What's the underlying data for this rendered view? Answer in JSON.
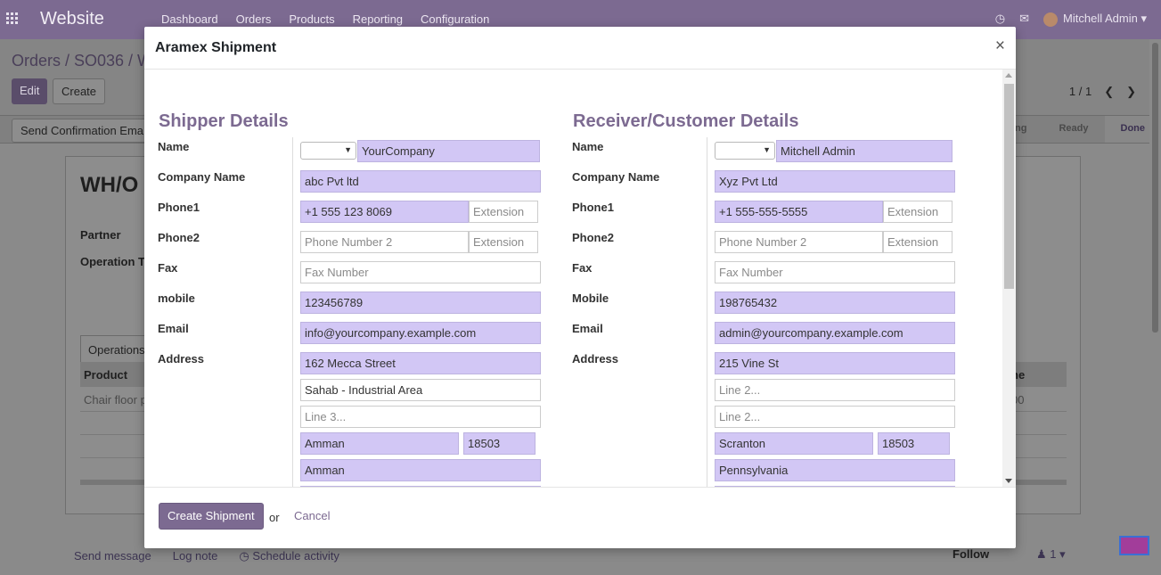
{
  "navbar": {
    "brand": "Website",
    "menu": [
      "Dashboard",
      "Orders",
      "Products",
      "Reporting",
      "Configuration"
    ],
    "user": "Mitchell Admin"
  },
  "background": {
    "breadcrumb": "Orders / SO036 / W",
    "edit_label": "Edit",
    "create_label": "Create",
    "pager": "1 / 1",
    "send_confirmation_label": "Send Confirmation Ema",
    "states": [
      "ng",
      "Ready",
      "Done"
    ],
    "record_title": "WH/O",
    "partner_label": "Partner",
    "operation_type_label": "Operation T",
    "operations_tab": "Operations",
    "product_header": "Product",
    "right_header": "ne",
    "row_product": "Chair floor p",
    "row_right": "00",
    "chatter": {
      "send_message": "Send message",
      "log_note": "Log note",
      "schedule_activity": "Schedule activity",
      "follow": "Follow",
      "followers": "1"
    }
  },
  "modal": {
    "title": "Aramex Shipment",
    "close": "×",
    "create_shipment_label": "Create Shipment",
    "or_text": "or",
    "cancel_label": "Cancel",
    "shipper": {
      "title": "Shipper Details",
      "labels": {
        "name": "Name",
        "company": "Company Name",
        "phone1": "Phone1",
        "phone2": "Phone2",
        "fax": "Fax",
        "mobile": "mobile",
        "email": "Email",
        "address": "Address"
      },
      "name": "YourCompany",
      "company": "abc Pvt ltd",
      "phone1": "+1 555 123 8069",
      "phone1_ext": "",
      "phone2": "",
      "phone2_ext": "",
      "fax": "",
      "mobile": "123456789",
      "email": "info@yourcompany.example.com",
      "address1": "162 Mecca Street",
      "address2": "Sahab - Industrial Area",
      "address3": "",
      "city": "Amman",
      "zip": "18503",
      "state": "Amman"
    },
    "receiver": {
      "title": "Receiver/Customer Details",
      "labels": {
        "name": "Name",
        "company": "Company Name",
        "phone1": "Phone1",
        "phone2": "Phone2",
        "fax": "Fax",
        "mobile": "Mobile",
        "email": "Email",
        "address": "Address"
      },
      "name": "Mitchell Admin",
      "company": "Xyz Pvt Ltd",
      "phone1": "+1 555-555-5555",
      "phone1_ext": "",
      "phone2": "",
      "phone2_ext": "",
      "fax": "",
      "mobile": "198765432",
      "email": "admin@yourcompany.example.com",
      "address1": "215 Vine St",
      "address2": "",
      "address3": "",
      "city": "Scranton",
      "zip": "18503",
      "state": "Pennsylvania"
    },
    "placeholders": {
      "extension": "Extension",
      "phone2": "Phone Number 2",
      "fax": "Fax Number",
      "line2": "Line 2...",
      "line3": "Line 3..."
    }
  }
}
